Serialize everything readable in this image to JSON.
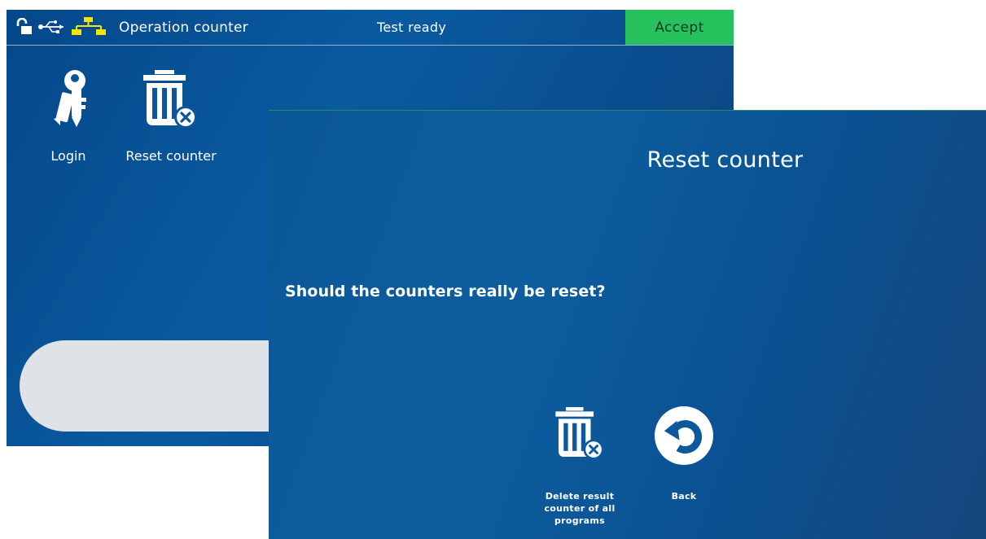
{
  "topbar": {
    "title": "Operation counter",
    "status": "Test ready",
    "accept_label": "Accept",
    "icons": [
      "unlock-icon",
      "usb-icon",
      "network-icon"
    ],
    "colors": {
      "accept": "#27c25d",
      "network": "#f2e600"
    }
  },
  "tiles": {
    "login_label": "Login",
    "reset_label": "Reset counter"
  },
  "dialog": {
    "title": "Reset counter",
    "question": "Should the counters really be reset?",
    "delete_label_line1": "Delete result",
    "delete_label_line2": "counter of all",
    "delete_label_line3": "programs",
    "back_label": "Back"
  }
}
